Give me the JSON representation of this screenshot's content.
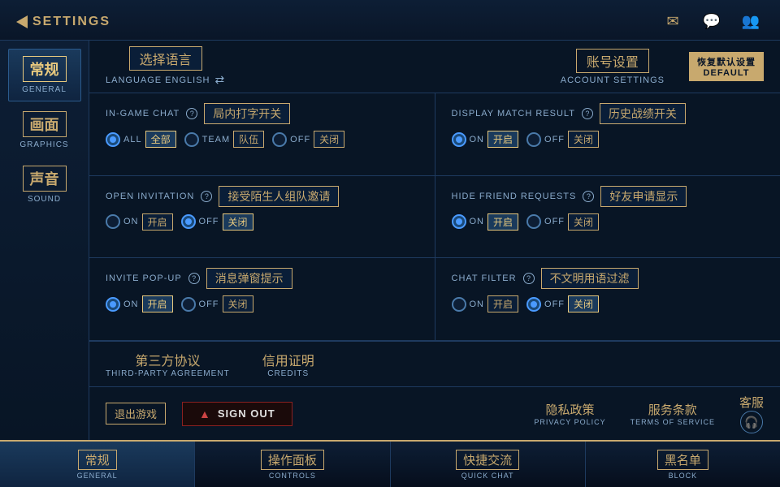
{
  "header": {
    "back_label": "SETTINGS",
    "icons": [
      "envelope-icon",
      "chat-icon",
      "friends-icon"
    ]
  },
  "sidebar": {
    "items": [
      {
        "cn": "常规",
        "en": "GENERAL",
        "active": true
      },
      {
        "cn": "画面",
        "en": "GRAPHICS",
        "active": false
      },
      {
        "cn": "声音",
        "en": "SOUND",
        "active": false
      }
    ]
  },
  "top_controls": {
    "language": {
      "cn": "选择语言",
      "en": "LANGUAGE ENGLISH"
    },
    "account": {
      "cn": "账号设置",
      "en": "ACCOUNT SETTINGS"
    },
    "default": {
      "cn": "恢复默认设置",
      "label": "DEFAULT"
    }
  },
  "settings": {
    "rows": [
      {
        "left": {
          "en_label": "IN-GAME CHAT",
          "cn_label": "局内打字开关",
          "options": [
            {
              "en": "ALL",
              "cn": "全部",
              "selected": true
            },
            {
              "en": "TEAM",
              "cn": "队伍",
              "selected": false
            },
            {
              "en": "OFF",
              "cn": "关闭",
              "selected": false
            }
          ]
        },
        "right": {
          "en_label": "DISPLAY MATCH RESULT",
          "cn_label": "历史战绩开关",
          "options": [
            {
              "en": "ON",
              "cn": "开启",
              "selected": true
            },
            {
              "en": "OFF",
              "cn": "关闭",
              "selected": false
            }
          ]
        }
      },
      {
        "left": {
          "en_label": "OPEN INVITATION",
          "cn_label": "接受陌生人组队邀请",
          "options": [
            {
              "en": "ON",
              "cn": "开启",
              "selected": false
            },
            {
              "en": "OFF",
              "cn": "关闭",
              "selected": true
            }
          ]
        },
        "right": {
          "en_label": "HIDE FRIEND REQUESTS",
          "cn_label": "好友申请显示",
          "options": [
            {
              "en": "ON",
              "cn": "开启",
              "selected": true
            },
            {
              "en": "OFF",
              "cn": "关闭",
              "selected": false
            }
          ]
        }
      },
      {
        "left": {
          "en_label": "INVITE POP-UP",
          "cn_label": "消息弹窗提示",
          "options": [
            {
              "en": "ON",
              "cn": "开启",
              "selected": true
            },
            {
              "en": "OFF",
              "cn": "关闭",
              "selected": false
            }
          ]
        },
        "right": {
          "en_label": "CHAT FILTER",
          "cn_label": "不文明用语过滤",
          "options": [
            {
              "en": "ON",
              "cn": "开启",
              "selected": false
            },
            {
              "en": "OFF",
              "cn": "关闭",
              "selected": true
            }
          ]
        }
      }
    ]
  },
  "bottom_links": [
    {
      "cn": "第三方协议",
      "en": "THIRD-PARTY AGREEMENT"
    },
    {
      "cn": "信用证明",
      "en": "CREDITS"
    }
  ],
  "signout": {
    "cn_btn": "退出游戏",
    "btn_label": "SIGN OUT"
  },
  "right_links": [
    {
      "cn": "隐私政策",
      "en": "PRIVACY POLICY"
    },
    {
      "cn": "服务条款",
      "en": "TERMS OF SERVICE"
    },
    {
      "cn": "客服",
      "en": ""
    }
  ],
  "bottom_nav": [
    {
      "cn": "常规",
      "en": "GENERAL",
      "active": true
    },
    {
      "cn": "操作面板",
      "en": "CONTROLS",
      "active": false
    },
    {
      "cn": "快捷交流",
      "en": "QUICK CHAT",
      "active": false
    },
    {
      "cn": "黑名单",
      "en": "BLOCK",
      "active": false
    }
  ]
}
